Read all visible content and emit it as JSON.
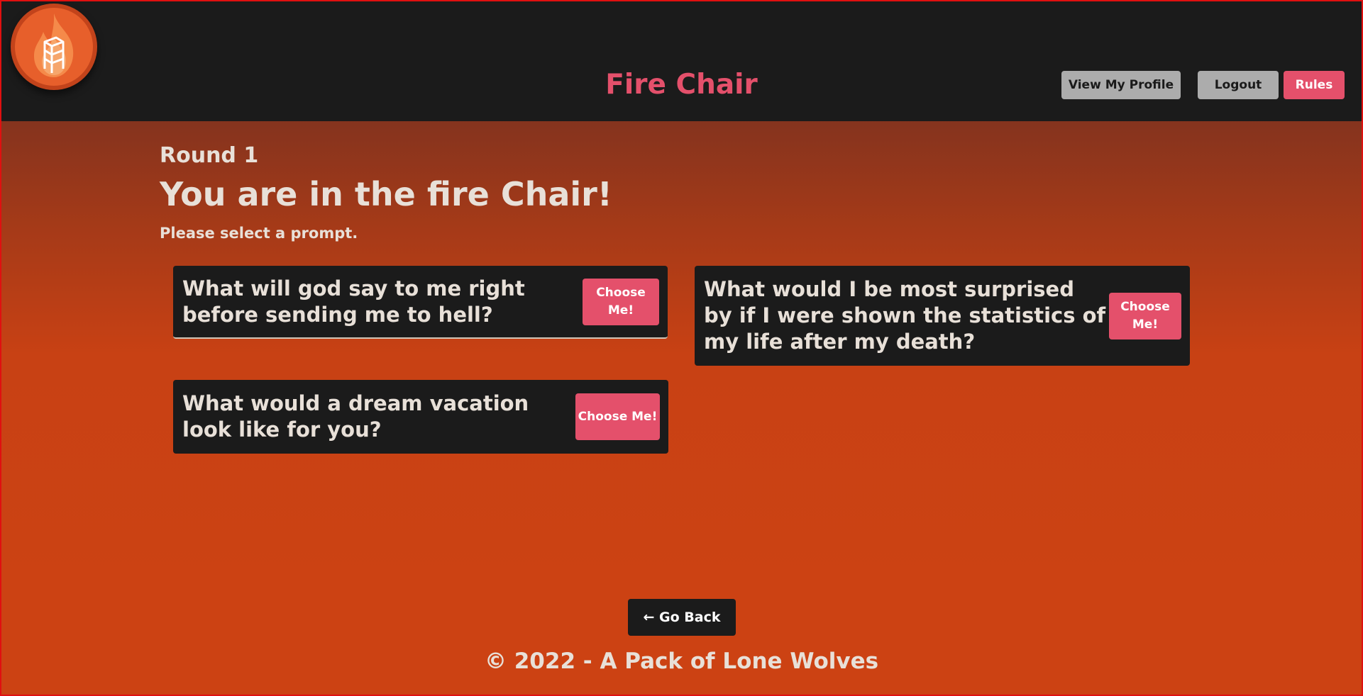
{
  "header": {
    "title": "Fire Chair",
    "logo_icon": "fire-chair-logo",
    "buttons": {
      "profile": "View My Profile",
      "logout": "Logout",
      "rules": "Rules"
    }
  },
  "main": {
    "round": "Round 1",
    "headline": "You are in the fire Chair!",
    "instruction": "Please select a prompt.",
    "prompts": [
      {
        "question": "What will god say to me right before sending me to hell?",
        "button": "Choose Me!"
      },
      {
        "question": "What would I be most surprised by if I were shown the statistics of my life after my death?",
        "button": "Choose Me!"
      },
      {
        "question": "What would a dream vacation look like for you?",
        "button": "Choose Me!"
      }
    ],
    "go_back": "← Go Back"
  },
  "footer": {
    "text": "© 2022 - A Pack of Lone Wolves"
  },
  "colors": {
    "accent": "#e4506b",
    "header_bg": "#1b1b1b",
    "card_bg": "#1b1b1b",
    "grey_button": "#acacac",
    "text": "#e8e0d8",
    "background_top": "#5e2a1e",
    "background_bottom": "#cc4213"
  }
}
